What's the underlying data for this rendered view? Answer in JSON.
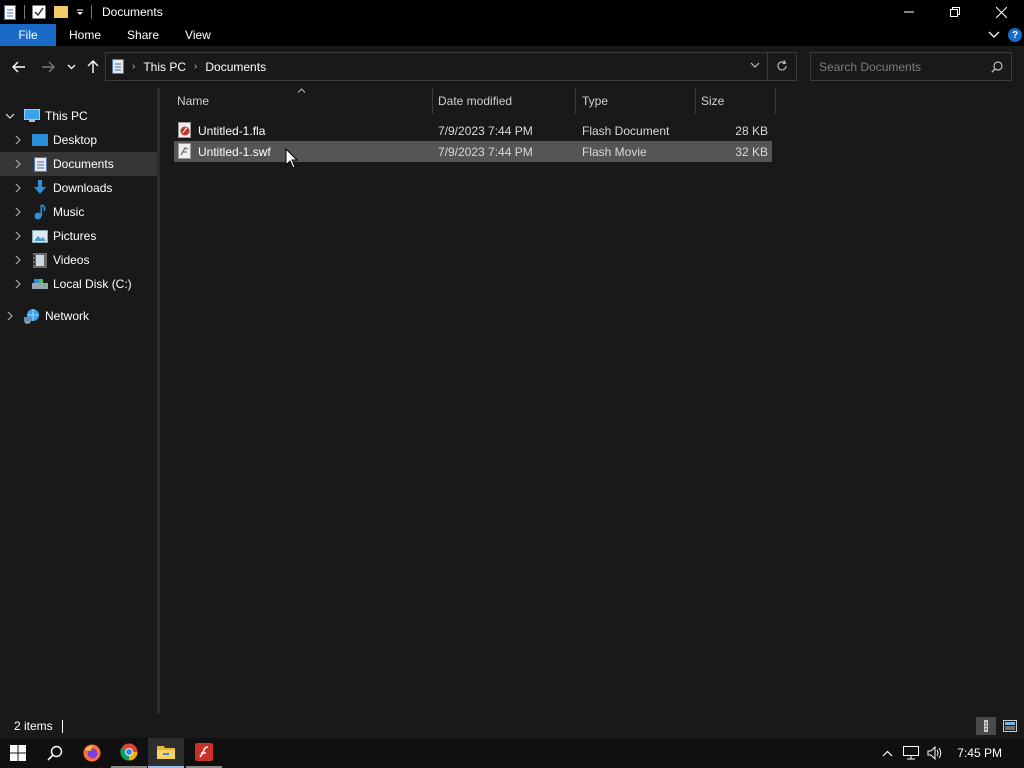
{
  "window": {
    "title": "Documents"
  },
  "ribbon": {
    "tabs": [
      "File",
      "Home",
      "Share",
      "View"
    ]
  },
  "address": {
    "breadcrumb": [
      "This PC",
      "Documents"
    ],
    "search_placeholder": "Search Documents"
  },
  "nav": {
    "items": [
      {
        "label": "This PC",
        "icon": "pc-icon",
        "expanded": true,
        "selected": false
      },
      {
        "label": "Desktop",
        "icon": "desktop-icon",
        "expanded": false,
        "selected": false
      },
      {
        "label": "Documents",
        "icon": "documents-icon",
        "expanded": false,
        "selected": true
      },
      {
        "label": "Downloads",
        "icon": "downloads-icon",
        "expanded": false,
        "selected": false
      },
      {
        "label": "Music",
        "icon": "music-icon",
        "expanded": false,
        "selected": false
      },
      {
        "label": "Pictures",
        "icon": "pictures-icon",
        "expanded": false,
        "selected": false
      },
      {
        "label": "Videos",
        "icon": "videos-icon",
        "expanded": false,
        "selected": false
      },
      {
        "label": "Local Disk (C:)",
        "icon": "drive-icon",
        "expanded": false,
        "selected": false
      },
      {
        "label": "Network",
        "icon": "network-icon",
        "expanded": false,
        "selected": false
      }
    ]
  },
  "files": {
    "columns": [
      "Name",
      "Date modified",
      "Type",
      "Size"
    ],
    "rows": [
      {
        "name": "Untitled-1.fla",
        "date": "7/9/2023 7:44 PM",
        "type": "Flash Document",
        "size": "28 KB",
        "icon": "fla-file-icon",
        "selected": false
      },
      {
        "name": "Untitled-1.swf",
        "date": "7/9/2023 7:44 PM",
        "type": "Flash Movie",
        "size": "32 KB",
        "icon": "swf-file-icon",
        "selected": true
      }
    ]
  },
  "status": {
    "item_count": "2 items"
  },
  "taskbar": {
    "time": "7:45 PM",
    "apps": [
      "start-icon",
      "search-icon",
      "firefox-icon",
      "chrome-icon",
      "file-explorer-icon",
      "adobe-animate-icon"
    ]
  },
  "colors": {
    "accent": "#1a6ac7",
    "selection": "#555555",
    "pane_bg": "#191919"
  }
}
